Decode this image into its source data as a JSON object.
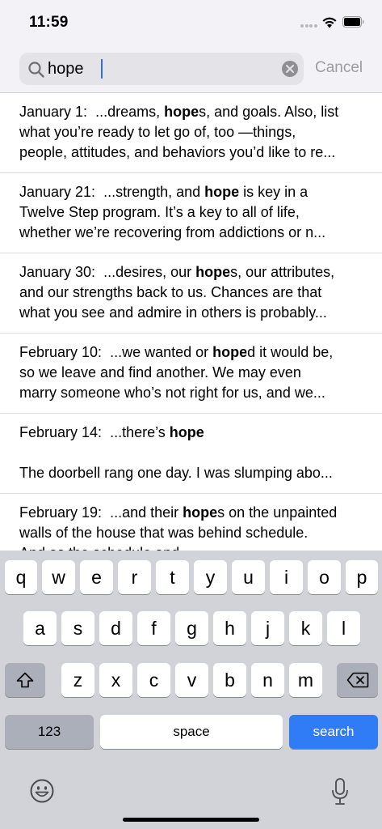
{
  "status_bar": {
    "time": "11:59"
  },
  "search": {
    "query": "hope",
    "cancel_label": "Cancel"
  },
  "results": [
    {
      "date": "January 1:",
      "before": "...dreams, ",
      "match": "hope",
      "after": "s, and goals. Also, list",
      "line2": "what you’re ready to let go of, too —things,",
      "line3": "people, attitudes, and behaviors you’d like to re..."
    },
    {
      "date": "January 21:",
      "before": "...strength, and ",
      "match": "hope",
      "after": " is key in a",
      "line2": "Twelve Step program. It’s a key to all of life,",
      "line3": "whether we’re recovering from addictions or n..."
    },
    {
      "date": "January 30:",
      "before": "...desires, our ",
      "match": "hope",
      "after": "s, our attributes,",
      "line2": "and our strengths back to us. Chances are that",
      "line3": "what you see and admire in others is probably..."
    },
    {
      "date": "February 10:",
      "before": "...we wanted or ",
      "match": "hope",
      "after": "d it would be,",
      "line2": "so we leave and find another. We may even",
      "line3": "marry someone who’s not right for us, and we..."
    },
    {
      "date": "February 14:",
      "before": "...there’s ",
      "match": "hope",
      "after": "",
      "line2": "",
      "line3": "The doorbell rang one day. I was slumping abo..."
    },
    {
      "date": "February 19:",
      "before": "...and their ",
      "match": "hope",
      "after": "s on the unpainted",
      "line2": "walls of the house that was behind schedule.",
      "line3": "And as the schedule and..."
    }
  ],
  "keyboard": {
    "row1": [
      "q",
      "w",
      "e",
      "r",
      "t",
      "y",
      "u",
      "i",
      "o",
      "p"
    ],
    "row2": [
      "a",
      "s",
      "d",
      "f",
      "g",
      "h",
      "j",
      "k",
      "l"
    ],
    "row3": [
      "z",
      "x",
      "c",
      "v",
      "b",
      "n",
      "m"
    ],
    "numbers_label": "123",
    "space_label": "space",
    "search_label": "search"
  },
  "colors": {
    "accent": "#2f7cf6",
    "caret": "#2f6fe4",
    "cancel": "#9c9ca2",
    "keyboard_bg": "#d1d3d9"
  },
  "icons": [
    "search-icon",
    "clear-icon",
    "wifi-icon",
    "battery-icon",
    "shift-icon",
    "backspace-icon",
    "emoji-icon",
    "microphone-icon"
  ]
}
